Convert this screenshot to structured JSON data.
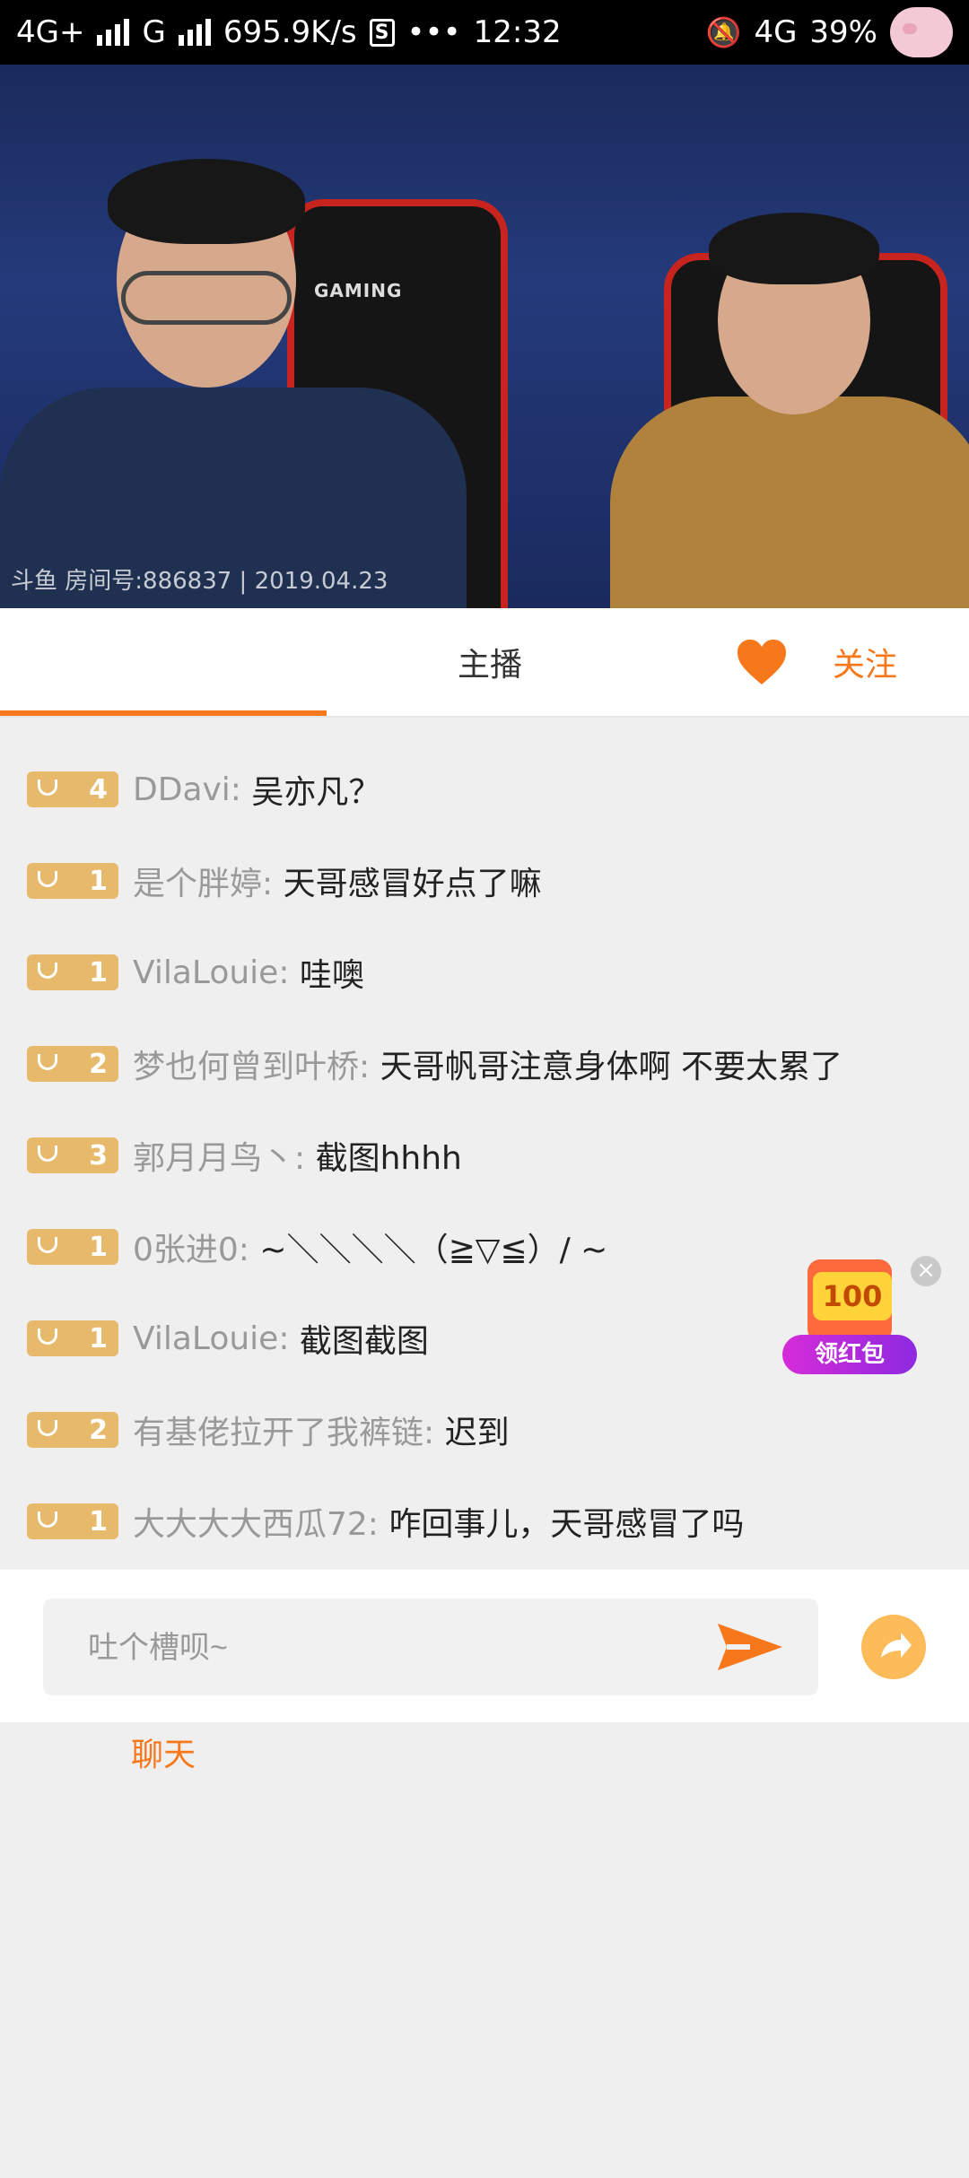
{
  "statusbar": {
    "network1": "4G+",
    "network2": "G",
    "speed": "695.9K/s",
    "sim_icon": "sim-s-icon",
    "dots": "•••",
    "time": "12:32",
    "network3": "4G",
    "battery": "39%"
  },
  "video": {
    "watermark": "斗鱼 房间号:886837 | 2019.04.23",
    "chair_label": "GAMING"
  },
  "tabs": {
    "chat": "聊天",
    "host": "主播",
    "follow": "关注"
  },
  "colors": {
    "accent": "#f7781a",
    "badge": "#e7b96b"
  },
  "messages": [
    {
      "level": "4",
      "user": "DDavi:",
      "text": "吴亦凡？"
    },
    {
      "level": "1",
      "user": "是个胖婷:",
      "text": "天哥感冒好点了嘛"
    },
    {
      "level": "1",
      "user": "VilaLouie:",
      "text": "哇噢"
    },
    {
      "level": "2",
      "user": "梦也何曾到叶桥:",
      "text": "天哥帆哥注意身体啊 不要太累了"
    },
    {
      "level": "3",
      "user": "郭月月鸟丶:",
      "text": "截图hhhh"
    },
    {
      "level": "1",
      "user": "0张进0:",
      "text": "~＼＼＼＼（≧▽≦）/ ~"
    },
    {
      "level": "1",
      "user": "VilaLouie:",
      "text": "截图截图"
    },
    {
      "level": "2",
      "user": "有基佬拉开了我裤链:",
      "text": "迟到"
    },
    {
      "level": "1",
      "user": "大大大大西瓜72:",
      "text": "咋回事儿，天哥感冒了吗"
    }
  ],
  "red_packet": {
    "amount": "100",
    "label": "领红包"
  },
  "input": {
    "placeholder": "吐个槽呗~"
  }
}
